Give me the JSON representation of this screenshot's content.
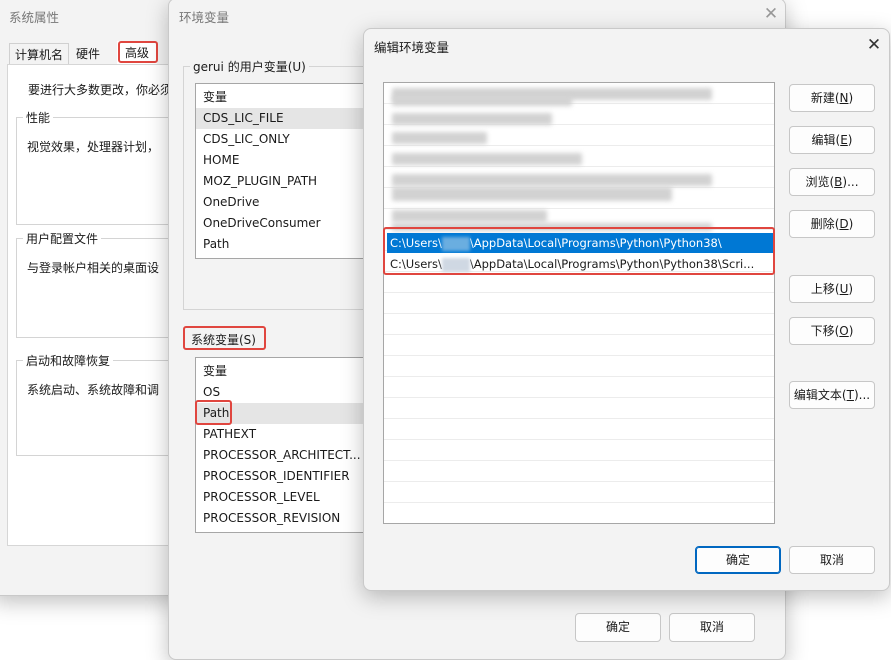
{
  "sys_props": {
    "title": "系统属性",
    "tabs": [
      "计算机名",
      "硬件",
      "高级"
    ],
    "intro": "要进行大多数更改，你必须",
    "performance": {
      "title": "性能",
      "desc": "视觉效果，处理器计划，"
    },
    "user_profile": {
      "title": "用户配置文件",
      "desc": "与登录帐户相关的桌面设"
    },
    "startup": {
      "title": "启动和故障恢复",
      "desc": "系统启动、系统故障和调"
    }
  },
  "env_vars": {
    "title": "环境变量",
    "user_section": "gerui 的用户变量(U)",
    "user_header": "变量",
    "user_vars": [
      "CDS_LIC_FILE",
      "CDS_LIC_ONLY",
      "HOME",
      "MOZ_PLUGIN_PATH",
      "OneDrive",
      "OneDriveConsumer",
      "Path"
    ],
    "sys_section": "系统变量(S)",
    "sys_header": "变量",
    "sys_vars": [
      "OS",
      "Path",
      "PATHEXT",
      "PROCESSOR_ARCHITECT...",
      "PROCESSOR_IDENTIFIER",
      "PROCESSOR_LEVEL",
      "PROCESSOR_REVISION"
    ],
    "ok": "确定",
    "cancel": "取消"
  },
  "edit_env": {
    "title": "编辑环境变量",
    "path_1_prefix": "C:\\Users\\",
    "path_1_suffix": "\\AppData\\Local\\Programs\\Python\\Python38\\",
    "path_2_prefix": "C:\\Users\\",
    "path_2_suffix": "\\AppData\\Local\\Programs\\Python\\Python38\\Scri...",
    "new_btn": "新建",
    "new_key": "N",
    "edit_btn": "编辑",
    "edit_key": "E",
    "browse_btn": "浏览",
    "browse_key": "B",
    "delete_btn": "删除",
    "delete_key": "D",
    "up_btn": "上移",
    "up_key": "U",
    "down_btn": "下移",
    "down_key": "O",
    "edit_text_btn": "编辑文本",
    "edit_text_key": "T",
    "ok": "确定",
    "cancel": "取消"
  },
  "colors": {
    "highlight": "#e0463f",
    "selection": "#0078d4",
    "accent_border": "#0067c0"
  }
}
